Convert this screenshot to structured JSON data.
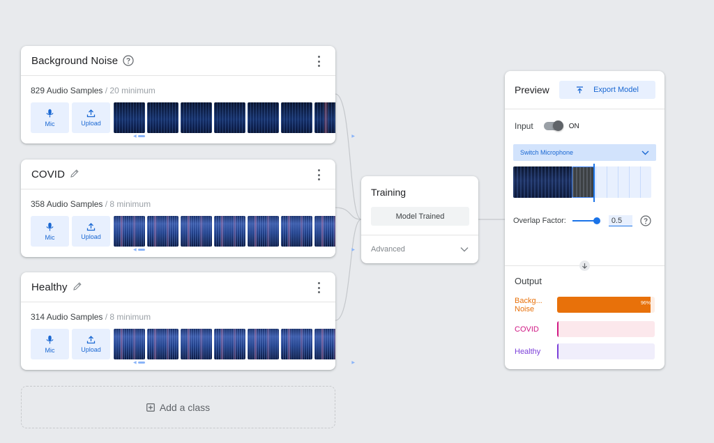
{
  "classes": [
    {
      "title": "Background Noise",
      "title_icon": "help-circle-icon",
      "samples": "829 Audio Samples",
      "minimum": "/ 20 minimum",
      "mic_label": "Mic",
      "upload_label": "Upload",
      "thumb_style": "noise"
    },
    {
      "title": "COVID",
      "title_icon": "pencil-icon",
      "samples": "358 Audio Samples",
      "minimum": "/ 8 minimum",
      "mic_label": "Mic",
      "upload_label": "Upload",
      "thumb_style": "cough"
    },
    {
      "title": "Healthy",
      "title_icon": "pencil-icon",
      "samples": "314 Audio Samples",
      "minimum": "/ 8 minimum",
      "mic_label": "Mic",
      "upload_label": "Upload",
      "thumb_style": "cough"
    }
  ],
  "add_class_label": "Add a class",
  "training": {
    "title": "Training",
    "button_label": "Model Trained",
    "advanced_label": "Advanced"
  },
  "preview": {
    "title": "Preview",
    "export_label": "Export Model",
    "input_label": "Input",
    "toggle_state": "ON",
    "switch_mic_label": "Switch Microphone",
    "overlap_label": "Overlap Factor:",
    "overlap_value": "0.5",
    "output_title": "Output",
    "outputs": [
      {
        "label": "Background Noise",
        "label_display": "Backg... Noise",
        "percent": 96,
        "percent_label": "96%",
        "color": "#e8710a",
        "track": "#fdeee4"
      },
      {
        "label": "COVID",
        "label_display": "COVID",
        "percent": 1,
        "percent_label": "",
        "color": "#d01884",
        "track": "#fce8ec"
      },
      {
        "label": "Healthy",
        "label_display": "Healthy",
        "percent": 1,
        "percent_label": "",
        "color": "#7b3fd9",
        "track": "#f0eefb"
      }
    ]
  },
  "colors": {
    "accent": "#1967d2",
    "accent_bg": "#e8f0fe",
    "background": "#e8eaed"
  }
}
